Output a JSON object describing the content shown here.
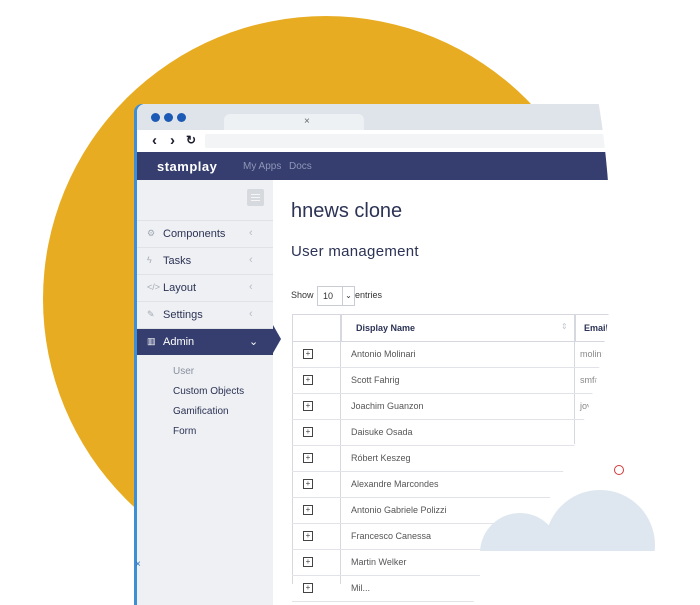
{
  "browser": {
    "tab_close": "×",
    "nav": {
      "back": "‹",
      "forward": "›",
      "reload": "↻"
    }
  },
  "app": {
    "brand": "stamplay",
    "nav": [
      "My Apps",
      "Docs"
    ]
  },
  "sidebar": {
    "items": [
      {
        "label": "Components",
        "icon": "gears-icon"
      },
      {
        "label": "Tasks",
        "icon": "bolt-icon"
      },
      {
        "label": "Layout",
        "icon": "code-icon"
      },
      {
        "label": "Settings",
        "icon": "wrench-icon"
      },
      {
        "label": "Admin",
        "icon": "chart-icon",
        "active": true
      }
    ],
    "subitems": [
      "User",
      "Custom Objects",
      "Gamification",
      "Form"
    ]
  },
  "main": {
    "title": "hnews clone",
    "section": "User management",
    "show_label": "Show",
    "entries_value": "10",
    "entries_label": "entries",
    "columns": [
      "Display Name",
      "Email"
    ],
    "rows": [
      {
        "name": "Antonio Molinari",
        "email": "molina"
      },
      {
        "name": "Scott Fahrig",
        "email": "smfa"
      },
      {
        "name": "Joachim Guanzon",
        "email": "jov"
      },
      {
        "name": "Daisuke Osada",
        "email": ""
      },
      {
        "name": "Róbert Keszeg",
        "email": ""
      },
      {
        "name": "Alexandre Marcondes",
        "email": ""
      },
      {
        "name": "Antonio Gabriele Polizzi",
        "email": ""
      },
      {
        "name": "Francesco Canessa",
        "email": ""
      },
      {
        "name": "Martin Welker",
        "email": ""
      },
      {
        "name": "Mil...",
        "email": ""
      }
    ]
  },
  "decor": {
    "cross": "×",
    "accent": "#e8ac22",
    "navy": "#353e6e"
  }
}
